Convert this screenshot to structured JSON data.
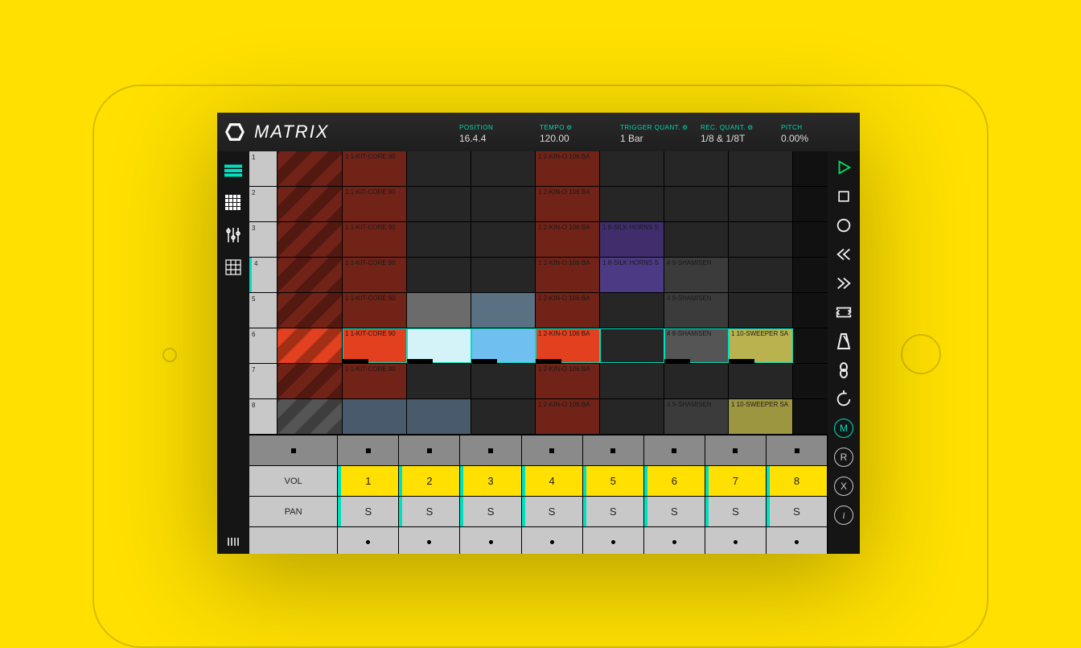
{
  "header": {
    "title": "MATRIX",
    "readouts": [
      {
        "label": "POSITION",
        "value": "16.4.4",
        "gear": false
      },
      {
        "label": "TEMPO",
        "value": "120.00",
        "gear": true
      },
      {
        "label": "TRIGGER QUANT.",
        "value": "1 Bar",
        "gear": true
      },
      {
        "label": "REC. QUANT.",
        "value": "1/8 & 1/8T",
        "gear": true
      },
      {
        "label": "PITCH",
        "value": "0.00%",
        "gear": false
      }
    ]
  },
  "left_rail": {
    "items": [
      "matrix-view",
      "grid-view",
      "mixer-view",
      "pads-view"
    ],
    "active": 0
  },
  "right_rail": {
    "buttons": [
      "play",
      "stop",
      "record",
      "skip-back",
      "skip-forward",
      "loop",
      "metronome",
      "tempo",
      "undo"
    ],
    "round": [
      "M",
      "R",
      "X",
      "i"
    ],
    "round_active": 0
  },
  "scenes": [
    "1",
    "2",
    "3",
    "4",
    "5",
    "6",
    "7",
    "8"
  ],
  "clip_labels": {
    "kit": "1 1-KIT-CORE 90",
    "kin": "1 2-KIN-O 106 BA",
    "silk": "1 8-SILK HORNS S",
    "sham": "4 9-SHAMISEN",
    "sweep": "1 10-SWEEPER SA"
  },
  "footer": {
    "stop_label": "",
    "vol_label": "VOL",
    "pan_label": "PAN",
    "tracks": [
      "1",
      "2",
      "3",
      "4",
      "5",
      "6",
      "7",
      "8"
    ],
    "pan_values": [
      "S",
      "S",
      "S",
      "S",
      "S",
      "S",
      "S",
      "S"
    ]
  }
}
